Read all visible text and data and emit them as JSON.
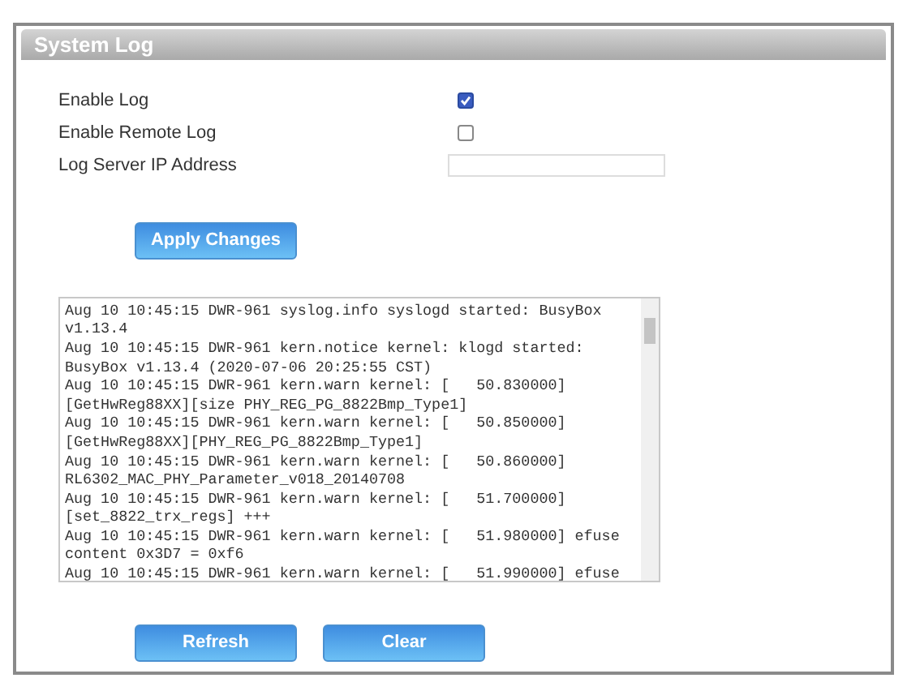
{
  "panel": {
    "title": "System Log"
  },
  "settings": [
    {
      "kind": "checkbox",
      "label": "Enable Log",
      "checked": true
    },
    {
      "kind": "checkbox",
      "label": "Enable Remote Log",
      "checked": false
    },
    {
      "kind": "text",
      "label": "Log Server IP Address"
    }
  ],
  "apply_button": "Apply Changes",
  "log": [
    "Aug 10 10:45:15 DWR-961 syslog.info syslogd started: BusyBox v1.13.4",
    "Aug 10 10:45:15 DWR-961 kern.notice kernel: klogd started: BusyBox v1.13.4 (2020-07-06 20:25:55 CST)",
    "Aug 10 10:45:15 DWR-961 kern.warn kernel: [   50.830000] [GetHwReg88XX][size PHY_REG_PG_8822Bmp_Type1]",
    "Aug 10 10:45:15 DWR-961 kern.warn kernel: [   50.850000] [GetHwReg88XX][PHY_REG_PG_8822Bmp_Type1]",
    "Aug 10 10:45:15 DWR-961 kern.warn kernel: [   50.860000] RL6302_MAC_PHY_Parameter_v018_20140708",
    "Aug 10 10:45:15 DWR-961 kern.warn kernel: [   51.700000] [set_8822_trx_regs] +++",
    "Aug 10 10:45:15 DWR-961 kern.warn kernel: [   51.980000] efuse content 0x3D7 = 0xf6",
    "Aug 10 10:45:15 DWR-961 kern.warn kernel: [   51.990000] efuse"
  ],
  "buttons": [
    "Refresh",
    "Clear"
  ]
}
